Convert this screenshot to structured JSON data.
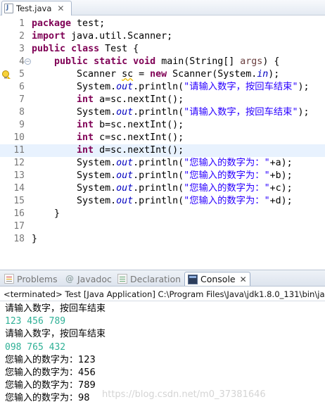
{
  "editor": {
    "tab_label": "Test.java",
    "current_line": 11,
    "lines": [
      {
        "n": "1",
        "fold": "",
        "parts": [
          [
            "kw",
            "package"
          ],
          [
            "plain",
            " test;"
          ]
        ]
      },
      {
        "n": "2",
        "fold": "",
        "parts": [
          [
            "kw",
            "import"
          ],
          [
            "plain",
            " java.util.Scanner;"
          ]
        ]
      },
      {
        "n": "3",
        "fold": "",
        "parts": [
          [
            "kw",
            "public"
          ],
          [
            "plain",
            " "
          ],
          [
            "kw",
            "class"
          ],
          [
            "plain",
            " Test {"
          ]
        ]
      },
      {
        "n": "4",
        "fold": "⊖",
        "parts": [
          [
            "plain",
            "    "
          ],
          [
            "kw",
            "public"
          ],
          [
            "plain",
            " "
          ],
          [
            "kw",
            "static"
          ],
          [
            "plain",
            " "
          ],
          [
            "kw",
            "void"
          ],
          [
            "plain",
            " main(String[] "
          ],
          [
            "argvar",
            "args"
          ],
          [
            "plain",
            ") {"
          ]
        ]
      },
      {
        "n": "5",
        "fold": "",
        "parts": [
          [
            "plain",
            "        Scanner "
          ],
          [
            "var-unused",
            "sc"
          ],
          [
            "plain",
            " = "
          ],
          [
            "kw",
            "new"
          ],
          [
            "plain",
            " Scanner(System."
          ],
          [
            "fld",
            "in"
          ],
          [
            "plain",
            ");"
          ]
        ]
      },
      {
        "n": "6",
        "fold": "",
        "parts": [
          [
            "plain",
            "        System."
          ],
          [
            "fld",
            "out"
          ],
          [
            "plain",
            ".println("
          ],
          [
            "str",
            "\"请输入数字，按回车结束\""
          ],
          [
            "plain",
            ");"
          ]
        ]
      },
      {
        "n": "7",
        "fold": "",
        "parts": [
          [
            "plain",
            "        "
          ],
          [
            "kw",
            "int"
          ],
          [
            "plain",
            " a=sc.nextInt();"
          ]
        ]
      },
      {
        "n": "8",
        "fold": "",
        "parts": [
          [
            "plain",
            "        System."
          ],
          [
            "fld",
            "out"
          ],
          [
            "plain",
            ".println("
          ],
          [
            "str",
            "\"请输入数字，按回车结束\""
          ],
          [
            "plain",
            ");"
          ]
        ]
      },
      {
        "n": "9",
        "fold": "",
        "parts": [
          [
            "plain",
            "        "
          ],
          [
            "kw",
            "int"
          ],
          [
            "plain",
            " b=sc.nextInt();"
          ]
        ]
      },
      {
        "n": "10",
        "fold": "",
        "parts": [
          [
            "plain",
            "        "
          ],
          [
            "kw",
            "int"
          ],
          [
            "plain",
            " c=sc.nextInt();"
          ]
        ]
      },
      {
        "n": "11",
        "fold": "",
        "parts": [
          [
            "plain",
            "        "
          ],
          [
            "kw",
            "int"
          ],
          [
            "plain",
            " d=sc.nextInt();"
          ]
        ]
      },
      {
        "n": "12",
        "fold": "",
        "parts": [
          [
            "plain",
            "        System."
          ],
          [
            "fld",
            "out"
          ],
          [
            "plain",
            ".println("
          ],
          [
            "str",
            "\"您输入的数字为：\""
          ],
          [
            "plain",
            "+a);"
          ]
        ]
      },
      {
        "n": "13",
        "fold": "",
        "parts": [
          [
            "plain",
            "        System."
          ],
          [
            "fld",
            "out"
          ],
          [
            "plain",
            ".println("
          ],
          [
            "str",
            "\"您输入的数字为：\""
          ],
          [
            "plain",
            "+b);"
          ]
        ]
      },
      {
        "n": "14",
        "fold": "",
        "parts": [
          [
            "plain",
            "        System."
          ],
          [
            "fld",
            "out"
          ],
          [
            "plain",
            ".println("
          ],
          [
            "str",
            "\"您输入的数字为：\""
          ],
          [
            "plain",
            "+c);"
          ]
        ]
      },
      {
        "n": "15",
        "fold": "",
        "parts": [
          [
            "plain",
            "        System."
          ],
          [
            "fld",
            "out"
          ],
          [
            "plain",
            ".println("
          ],
          [
            "str",
            "\"您输入的数字为：\""
          ],
          [
            "plain",
            "+d);"
          ]
        ]
      },
      {
        "n": "16",
        "fold": "",
        "parts": [
          [
            "plain",
            "    }"
          ]
        ]
      },
      {
        "n": "17",
        "fold": "",
        "parts": []
      },
      {
        "n": "18",
        "fold": "",
        "parts": [
          [
            "plain",
            "}"
          ]
        ]
      }
    ],
    "warning_lines": [
      5
    ]
  },
  "views": {
    "tabs": [
      {
        "label": "Problems",
        "icon": "problems-icon",
        "active": false
      },
      {
        "label": "Javadoc",
        "icon": "javadoc-icon",
        "active": false
      },
      {
        "label": "Declaration",
        "icon": "declaration-icon",
        "active": false
      },
      {
        "label": "Console",
        "icon": "console-icon",
        "active": true
      }
    ],
    "close_glyph": "✕"
  },
  "console": {
    "header": "<terminated> Test [Java Application] C:\\Program Files\\Java\\jdk1.8.0_131\\bin\\ja",
    "lines": [
      {
        "type": "output",
        "text": "请输入数字，按回车结束"
      },
      {
        "type": "input",
        "text": "123 456 789"
      },
      {
        "type": "output",
        "text": "请输入数字，按回车结束"
      },
      {
        "type": "input",
        "text": "098 765 432"
      },
      {
        "type": "output",
        "text": "您输入的数字为：123"
      },
      {
        "type": "output",
        "text": "您输入的数字为：456"
      },
      {
        "type": "output",
        "text": "您输入的数字为：789"
      },
      {
        "type": "output",
        "text": "您输入的数字为：98"
      }
    ]
  },
  "watermark": "https://blog.csdn.net/m0_37381646",
  "colors": {
    "keyword": "#7f0055",
    "string": "#2a00ff",
    "field": "#0000c0",
    "console_input": "#2fb096",
    "current_line": "#e8f2fe"
  }
}
